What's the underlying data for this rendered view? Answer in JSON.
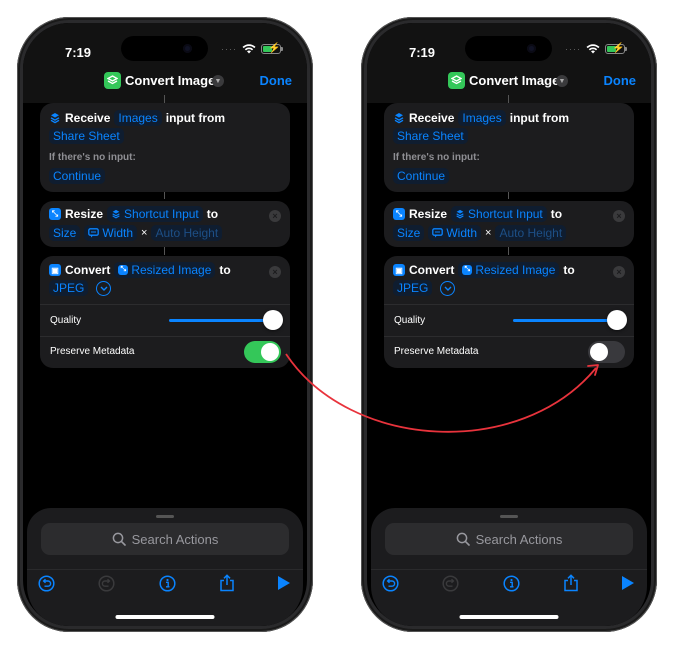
{
  "colors": {
    "accent": "#0a84ff",
    "toggle_on": "#34c759",
    "toggle_off": "#39393d",
    "annotation_arrow": "#e8333c",
    "app_icon": "#34c759"
  },
  "phones": [
    {
      "status": {
        "time": "7:19",
        "signal": "····"
      },
      "nav": {
        "title": "Convert Image",
        "done_label": "Done"
      },
      "receive": {
        "verb": "Receive",
        "type_token": "Images",
        "connector": "input from",
        "source_token": "Share Sheet",
        "no_input_label": "If there's no input:",
        "no_input_token": "Continue"
      },
      "resize": {
        "verb": "Resize",
        "input_token": "Shortcut Input",
        "to": "to",
        "mode_token": "Size",
        "width_token": "Width",
        "times": "×",
        "height_token": "Auto Height"
      },
      "convert": {
        "verb": "Convert",
        "input_token": "Resized Image",
        "to": "to",
        "format_token": "JPEG",
        "quality_label": "Quality",
        "quality_value": 1.0,
        "preserve_label": "Preserve Metadata",
        "preserve_on": true
      },
      "sheet": {
        "search_placeholder": "Search Actions"
      }
    },
    {
      "status": {
        "time": "7:19",
        "signal": "····"
      },
      "nav": {
        "title": "Convert Image",
        "done_label": "Done"
      },
      "receive": {
        "verb": "Receive",
        "type_token": "Images",
        "connector": "input from",
        "source_token": "Share Sheet",
        "no_input_label": "If there's no input:",
        "no_input_token": "Continue"
      },
      "resize": {
        "verb": "Resize",
        "input_token": "Shortcut Input",
        "to": "to",
        "mode_token": "Size",
        "width_token": "Width",
        "times": "×",
        "height_token": "Auto Height"
      },
      "convert": {
        "verb": "Convert",
        "input_token": "Resized Image",
        "to": "to",
        "format_token": "JPEG",
        "quality_label": "Quality",
        "quality_value": 1.0,
        "preserve_label": "Preserve Metadata",
        "preserve_on": false
      },
      "sheet": {
        "search_placeholder": "Search Actions"
      }
    }
  ]
}
